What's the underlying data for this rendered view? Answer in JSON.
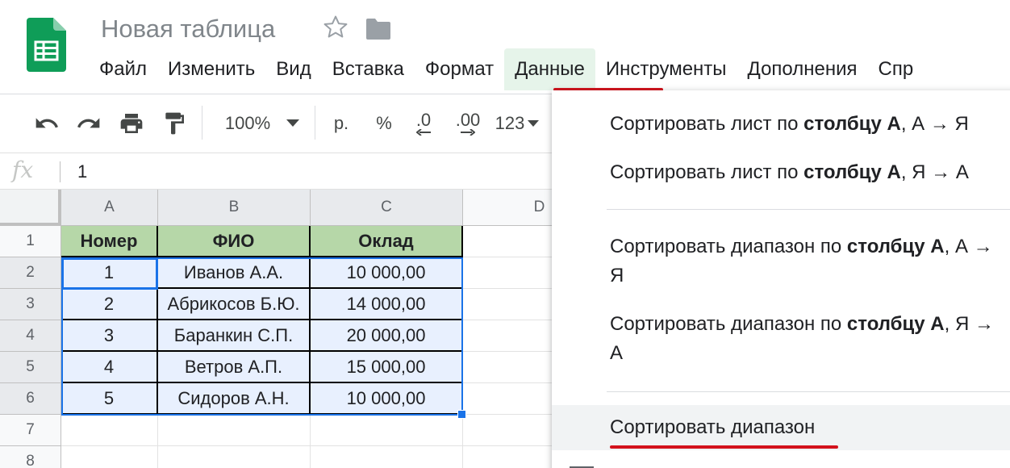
{
  "app": {
    "title": "Новая таблица",
    "icons": [
      "sheets-logo",
      "star-icon",
      "folder-icon"
    ],
    "accent_color": "#0f9d58"
  },
  "menubar": {
    "items": [
      "Файл",
      "Изменить",
      "Вид",
      "Вставка",
      "Формат",
      "Данные",
      "Инструменты",
      "Дополнения",
      "Спр"
    ],
    "active": "Данные"
  },
  "toolbar": {
    "zoom": "100%",
    "currency": "р.",
    "percent": "%",
    "decrease_decimals": ".0",
    "increase_decimals": ".00",
    "more_formats": "123",
    "icons": [
      "undo-icon",
      "redo-icon",
      "print-icon",
      "paint-format-icon"
    ]
  },
  "formula_bar": {
    "fx": "fx",
    "value": "1"
  },
  "grid": {
    "columns": [
      "A",
      "B",
      "C",
      "D"
    ],
    "rows": [
      "1",
      "2",
      "3",
      "4",
      "5",
      "6",
      "7",
      "8"
    ],
    "header_row": [
      "Номер",
      "ФИО",
      "Оклад"
    ],
    "data_rows": [
      [
        "1",
        "Иванов А.А.",
        "10 000,00"
      ],
      [
        "2",
        "Абрикосов Б.Ю.",
        "14 000,00"
      ],
      [
        "3",
        "Баранкин С.П.",
        "20 000,00"
      ],
      [
        "4",
        "Ветров А.П.",
        "15 000,00"
      ],
      [
        "5",
        "Сидоров А.Н.",
        "10 000,00"
      ]
    ],
    "header_fill": "#b6d7a8",
    "selection_fill": "#e8f0fe",
    "selection_color": "#1a73e8"
  },
  "dropdown": {
    "sort_sheet_az": {
      "prefix": "Сортировать лист по ",
      "bold": "столбцу А",
      "suffix": ", А → Я"
    },
    "sort_sheet_za": {
      "prefix": "Сортировать лист по ",
      "bold": "столбцу А",
      "suffix": ", Я → А"
    },
    "sort_range_az": {
      "prefix": "Сортировать диапазон по ",
      "bold": "столбцу А",
      "suffix": ", А →",
      "wrap": "Я"
    },
    "sort_range_za": {
      "prefix": "Сортировать диапазон по ",
      "bold": "столбцу А",
      "suffix": ", Я →",
      "wrap": "А"
    },
    "sort_range": "Сортировать диапазон",
    "highlight_color": "#d3121c"
  }
}
